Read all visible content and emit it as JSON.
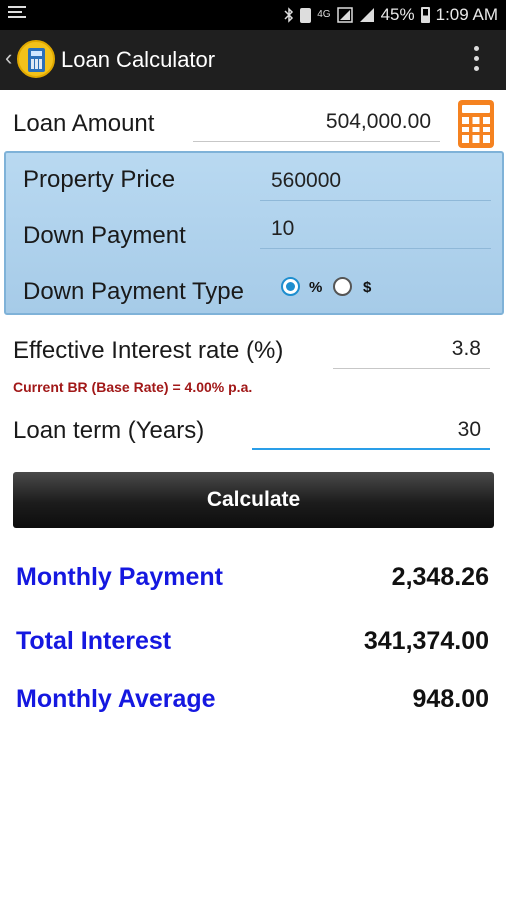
{
  "status_bar": {
    "battery": "45%",
    "time": "1:09 AM",
    "network_label": "4G"
  },
  "app_bar": {
    "title": "Loan Calculator"
  },
  "form": {
    "loan_amount": {
      "label": "Loan Amount",
      "value": "504,000.00"
    },
    "property_price": {
      "label": "Property Price",
      "value": "560000"
    },
    "down_payment": {
      "label": "Down Payment",
      "value": "10"
    },
    "down_payment_type": {
      "label": "Down Payment Type",
      "options": [
        "%",
        "$"
      ],
      "selected": "%"
    },
    "interest_rate": {
      "label": "Effective Interest rate (%)",
      "value": "3.8"
    },
    "base_rate_note": "Current BR (Base Rate) = 4.00% p.a.",
    "loan_term": {
      "label": "Loan term (Years)",
      "value": "30"
    }
  },
  "actions": {
    "calculate_label": "Calculate"
  },
  "results": {
    "monthly_payment": {
      "label": "Monthly Payment",
      "value": "2,348.26"
    },
    "total_interest": {
      "label": "Total Interest",
      "value": "341,374.00"
    },
    "monthly_average": {
      "label": "Monthly Average",
      "value": "948.00"
    }
  },
  "colors": {
    "result_label": "#1518e0",
    "note": "#a11818",
    "panel": "#b2d3ee",
    "accent": "#2a9ee8"
  }
}
